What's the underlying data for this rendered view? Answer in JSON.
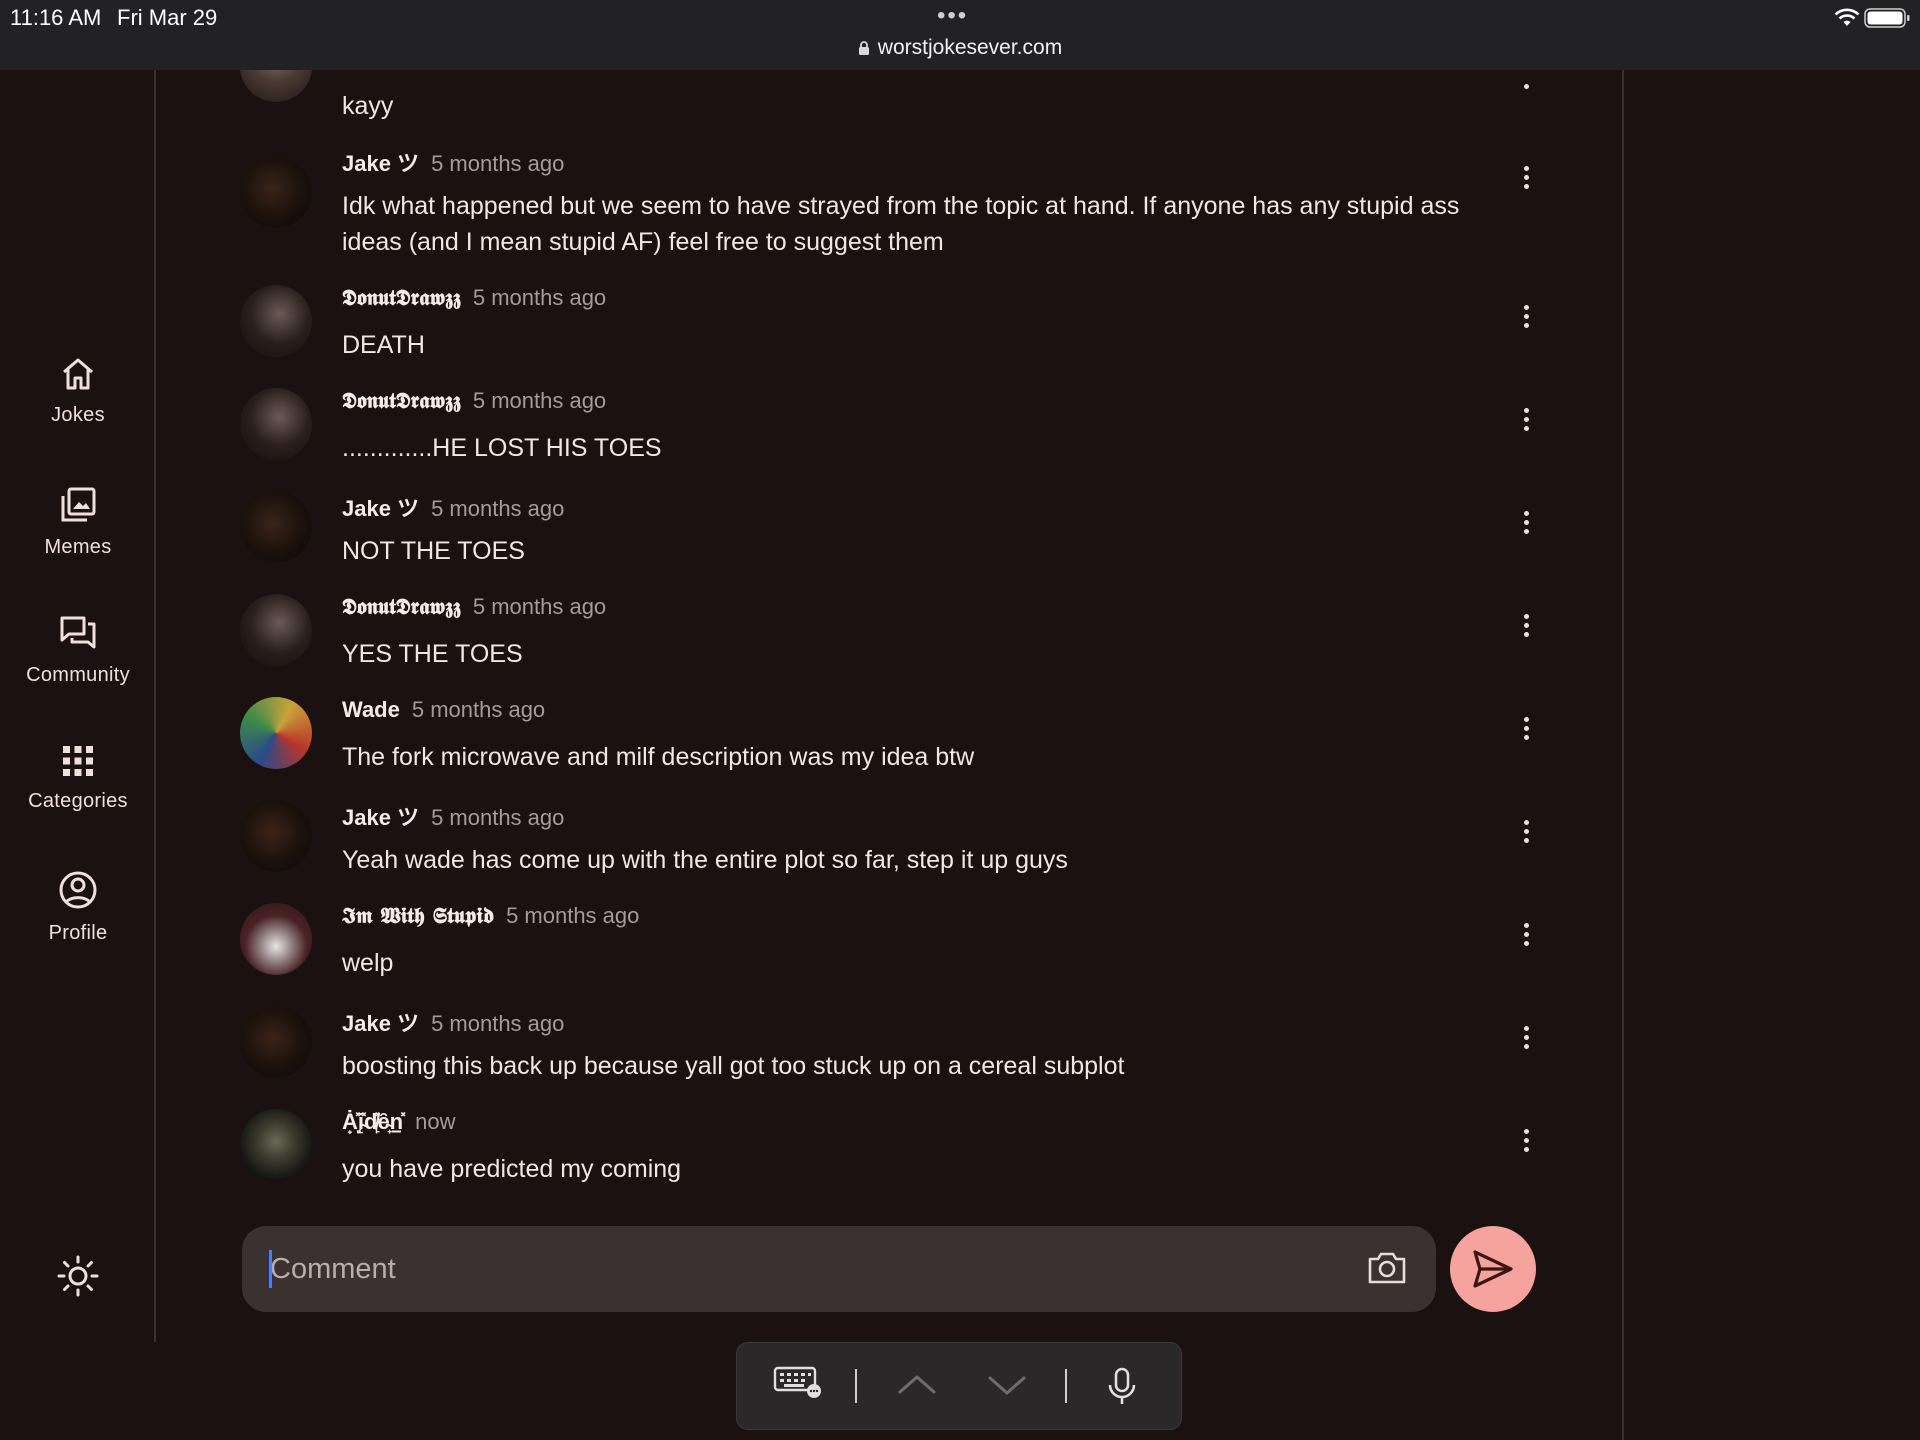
{
  "status_bar": {
    "time": "11:16 AM",
    "date": "Fri Mar 29",
    "dots": "•••",
    "url": "worstjokesever.com"
  },
  "nav": {
    "items": [
      {
        "label": "Jokes",
        "icon": "home-icon"
      },
      {
        "label": "Memes",
        "icon": "images-icon"
      },
      {
        "label": "Community",
        "icon": "forum-icon"
      },
      {
        "label": "Categories",
        "icon": "grid-icon"
      },
      {
        "label": "Profile",
        "icon": "account-icon"
      }
    ],
    "theme_icon": "sun-icon"
  },
  "comments": [
    {
      "author": "",
      "time": "",
      "text": "kayy"
    },
    {
      "author": "Jake ツ",
      "time": "5 months ago",
      "text": "Idk what happened but we seem to have strayed from the topic at hand. If anyone has any stupid ass ideas (and I mean stupid AF) feel free to suggest them"
    },
    {
      "author": "𝕯𝖔𝖓𝖚𝖙𝕯𝖗𝖆𝖜𝖟𝖟",
      "time": "5 months ago",
      "text": "DEATH"
    },
    {
      "author": "𝕯𝖔𝖓𝖚𝖙𝕯𝖗𝖆𝖜𝖟𝖟",
      "time": "5 months ago",
      "text": ".............HE LOST HIS TOES"
    },
    {
      "author": "Jake ツ",
      "time": "5 months ago",
      "text": "NOT THE TOES"
    },
    {
      "author": "𝕯𝖔𝖓𝖚𝖙𝕯𝖗𝖆𝖜𝖟𝖟",
      "time": "5 months ago",
      "text": "YES THE TOES"
    },
    {
      "author": "Wade",
      "time": "5 months ago",
      "text": "The fork microwave and milf description was my idea btw"
    },
    {
      "author": "Jake ツ",
      "time": "5 months ago",
      "text": "Yeah wade has come up with the entire plot so far, step it up guys"
    },
    {
      "author": "𝕴𝖒 𝖂𝖎𝖙𝖍 𝕾𝖙𝖚𝖕𝖎𝖉",
      "time": "5 months ago",
      "text": "welp"
    },
    {
      "author": "Jake ツ",
      "time": "5 months ago",
      "text": "boosting this back up because yall got too stuck up on a cereal subplot"
    },
    {
      "author": "Ȧ̟̽ͅį̴̽d̸̙̽ȇ̴̟n̠̽̽",
      "time": "now",
      "text": "you have predicted my coming"
    }
  ],
  "composer": {
    "placeholder": "Comment"
  },
  "colors": {
    "background": "#1b1111",
    "send_button": "#f7a39d",
    "input_bg": "#3b3131"
  }
}
